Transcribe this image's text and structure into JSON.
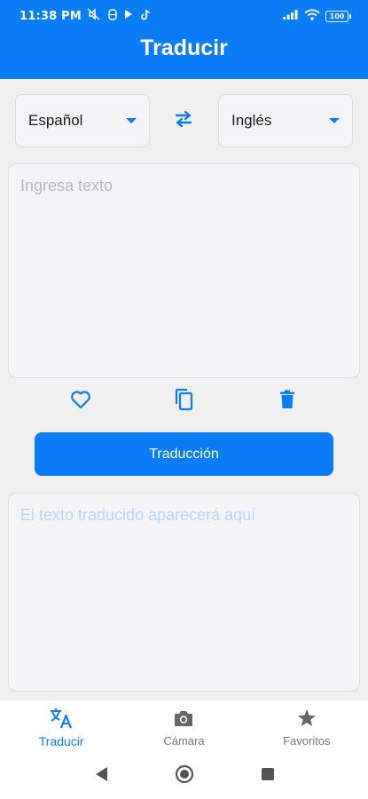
{
  "status_bar": {
    "time": "11:38 PM",
    "battery": "100",
    "left_icons": [
      "mute-icon",
      "data-saver-icon",
      "play-icon",
      "tiktok-icon"
    ],
    "right_icons": [
      "signal-icon",
      "wifi-icon",
      "battery-icon"
    ]
  },
  "header": {
    "title": "Traducir"
  },
  "languages": {
    "source": "Español",
    "target": "Inglés",
    "swap_icon": "swap-arrows-icon"
  },
  "input": {
    "placeholder": "Ingresa texto",
    "value": ""
  },
  "actions": {
    "favorite_icon": "heart-outline-icon",
    "copy_icon": "copy-icon",
    "delete_icon": "trash-icon"
  },
  "translate_button": {
    "label": "Traducción"
  },
  "output": {
    "placeholder": "El texto traducido aparecerá aquí"
  },
  "bottom_nav": {
    "items": [
      {
        "label": "Traducir",
        "icon": "translate-icon",
        "active": true
      },
      {
        "label": "Cámara",
        "icon": "camera-icon",
        "active": false
      },
      {
        "label": "Favoritos",
        "icon": "star-icon",
        "active": false
      }
    ]
  },
  "colors": {
    "primary": "#0a7cf5",
    "background": "#f0f0f0",
    "card": "#f4f4f6",
    "placeholder_input": "#b8b8bc",
    "placeholder_output": "#b9d6f5",
    "inactive_nav": "#777777"
  }
}
